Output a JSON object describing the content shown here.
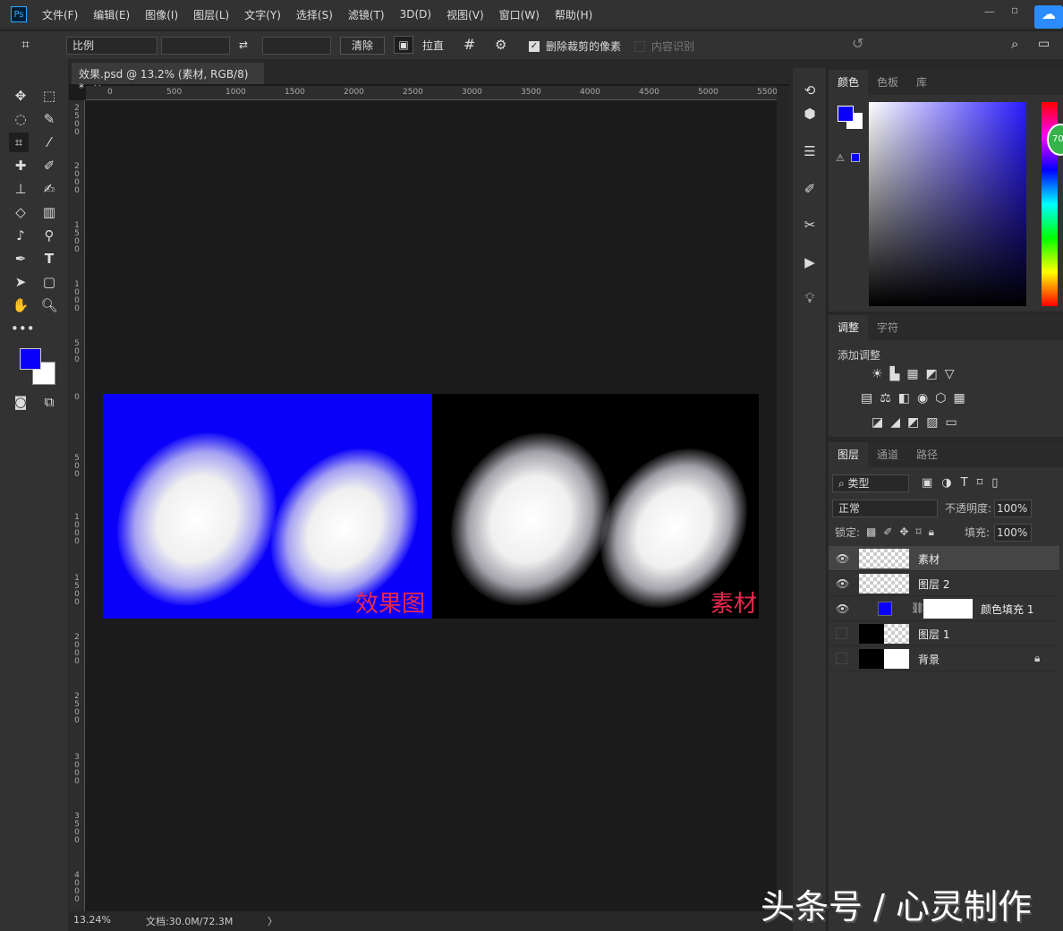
{
  "app": {
    "logo": "Ps"
  },
  "menu": [
    "文件(F)",
    "编辑(E)",
    "图像(I)",
    "图层(L)",
    "文字(Y)",
    "选择(S)",
    "滤镜(T)",
    "3D(D)",
    "视图(V)",
    "窗口(W)",
    "帮助(H)"
  ],
  "options": {
    "ratio": "比例",
    "ratio_w": "",
    "ratio_h": "",
    "clear": "清除",
    "straighten": "拉直",
    "delete_cropped": "删除裁剪的像素",
    "delete_cropped_checked": true,
    "content_aware": "内容识别",
    "content_aware_checked": false
  },
  "document": {
    "tab": "效果.psd @ 13.2% (素材, RGB/8) *",
    "close": "×",
    "zoom": "13.24%",
    "doc_size": "文档:30.0M/72.3M",
    "arrow": "〉",
    "hruler": [
      "0",
      "500",
      "1000",
      "1500",
      "2000",
      "2500",
      "3000",
      "3500",
      "4000",
      "4500",
      "5000",
      "5500"
    ],
    "vruler": [
      "2500",
      "2000",
      "1500",
      "1000",
      "500",
      "0",
      "500",
      "1000",
      "1500",
      "2000",
      "2500",
      "3000",
      "3500",
      "4000"
    ],
    "label_left": "效果图",
    "label_right": "素材",
    "fill_color": "#0a00f9"
  },
  "colors": {
    "foreground": "#0a00f9",
    "background": "#ffffff",
    "hue_value": "70"
  },
  "color_panel": {
    "tabs": [
      "颜色",
      "色板",
      "库"
    ]
  },
  "adjust_panel": {
    "tabs": [
      "调整",
      "字符"
    ],
    "title": "添加调整"
  },
  "layers_panel": {
    "tabs": [
      "图层",
      "通道",
      "路径"
    ],
    "filter": "类型",
    "blend": "正常",
    "opacity_label": "不透明度:",
    "opacity": "100%",
    "lock_label": "锁定:",
    "fill_label": "填充:",
    "fill": "100%",
    "layers": [
      {
        "name": "素材",
        "visible": true,
        "selected": true
      },
      {
        "name": "图层 2",
        "visible": true
      },
      {
        "name": "颜色填充 1",
        "visible": true
      },
      {
        "name": "图层 1",
        "visible": false
      },
      {
        "name": "背景",
        "visible": false,
        "locked": true
      }
    ]
  },
  "watermark": "头条号 / 心灵制作"
}
